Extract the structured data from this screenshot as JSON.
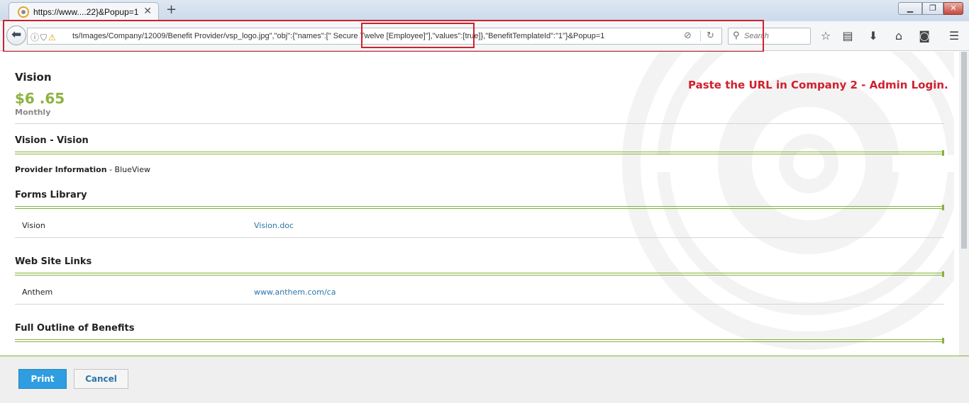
{
  "browser": {
    "tab_title": "https://www....22}&Popup=1",
    "tab_close": "✕",
    "new_tab": "+",
    "url": "ts/Images/Company/12009/Benefit Provider/vsp_logo.jpg\",\"obj\":{\"names\":[\" Secure  Twelve [Employee]\"],\"values\":[true]},\"BenefitTemplateId\":\"1\"}&Popup=1",
    "search_placeholder": "Search"
  },
  "annotation": {
    "text": "Paste the URL in Company 2 - Admin Login.",
    "color": "#d0202e"
  },
  "plan": {
    "title": "Vision",
    "price": "$6 .65",
    "period": "Monthly"
  },
  "sections": {
    "vision": {
      "title": "Vision - Vision"
    },
    "provider": {
      "label": "Provider Information",
      "value": " - BlueView"
    },
    "forms": {
      "title": "Forms Library",
      "rows": [
        {
          "name": "Vision",
          "link": "Vision.doc"
        }
      ]
    },
    "links": {
      "title": "Web Site Links",
      "rows": [
        {
          "name": "Anthem",
          "link": "www.anthem.com/ca"
        }
      ]
    },
    "outline": {
      "title": "Full Outline of Benefits"
    }
  },
  "footer": {
    "print_label": "Print",
    "cancel_label": "Cancel"
  },
  "colors": {
    "accent_green": "#8cb33e",
    "link_blue": "#2b77a8",
    "button_blue": "#2e9ee0"
  },
  "icons": [
    "back-arrow-icon",
    "info-icon",
    "shield-icon",
    "lock-warning-icon",
    "reader-view-icon",
    "reload-icon",
    "search-icon",
    "bookmark-star-icon",
    "reading-list-icon",
    "download-icon",
    "home-icon",
    "pocket-icon",
    "hamburger-menu-icon"
  ]
}
